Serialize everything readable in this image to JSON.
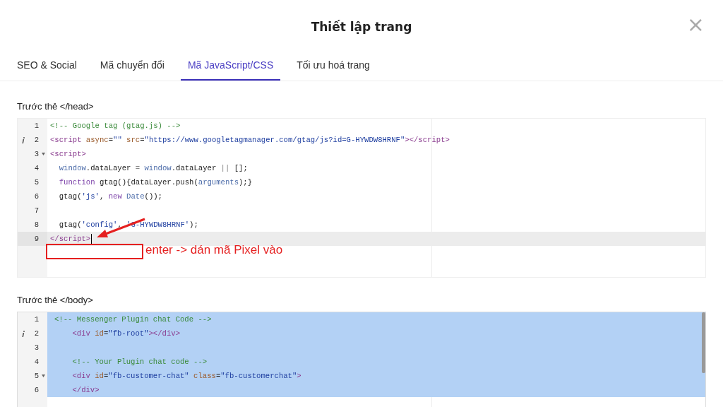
{
  "dialog": {
    "title": "Thiết lập trang",
    "close": "×"
  },
  "tabs": [
    {
      "label": "SEO & Social",
      "selected": false
    },
    {
      "label": "Mã chuyển đổi",
      "selected": false
    },
    {
      "label": "Mã JavaScript/CSS",
      "selected": true
    },
    {
      "label": "Tối ưu hoá trang",
      "selected": false
    }
  ],
  "editors": [
    {
      "label": "Trước thẻ </head>",
      "lines": [
        {
          "number": "1",
          "info": false,
          "foldable": false,
          "active": false,
          "selected": false,
          "tokens": [
            {
              "t": "<!-- Google tag (gtag.js) -->",
              "kind": "comment"
            }
          ]
        },
        {
          "number": "2",
          "info": true,
          "foldable": false,
          "active": false,
          "selected": false,
          "tokens": [
            {
              "t": "<script",
              "kind": "tag"
            },
            {
              "t": " async",
              "kind": "attr"
            },
            {
              "t": "=",
              "kind": "plain"
            },
            {
              "t": "\"\"",
              "kind": "string"
            },
            {
              "t": " src",
              "kind": "attr"
            },
            {
              "t": "=",
              "kind": "plain"
            },
            {
              "t": "\"https://www.googletagmanager.com/gtag/js?id=G-HYWDW8HRNF\"",
              "kind": "string"
            },
            {
              "t": "></script>",
              "kind": "tag"
            }
          ]
        },
        {
          "number": "3",
          "info": false,
          "foldable": true,
          "active": false,
          "selected": false,
          "tokens": [
            {
              "t": "<script>",
              "kind": "tag"
            }
          ]
        },
        {
          "number": "4",
          "info": false,
          "foldable": false,
          "active": false,
          "selected": false,
          "tokens": [
            {
              "t": "  window",
              "kind": "variable"
            },
            {
              "t": ".dataLayer ",
              "kind": "plain"
            },
            {
              "t": "=",
              "kind": "operator"
            },
            {
              "t": " window",
              "kind": "variable"
            },
            {
              "t": ".dataLayer ",
              "kind": "plain"
            },
            {
              "t": "||",
              "kind": "operator"
            },
            {
              "t": " [];",
              "kind": "plain"
            }
          ]
        },
        {
          "number": "5",
          "info": false,
          "foldable": false,
          "active": false,
          "selected": false,
          "tokens": [
            {
              "t": "  function",
              "kind": "keyword"
            },
            {
              "t": " gtag(){dataLayer.push(",
              "kind": "plain"
            },
            {
              "t": "arguments",
              "kind": "variable"
            },
            {
              "t": ");}",
              "kind": "plain"
            }
          ]
        },
        {
          "number": "6",
          "info": false,
          "foldable": false,
          "active": false,
          "selected": false,
          "tokens": [
            {
              "t": "  gtag(",
              "kind": "plain"
            },
            {
              "t": "'js'",
              "kind": "string"
            },
            {
              "t": ", ",
              "kind": "plain"
            },
            {
              "t": "new",
              "kind": "keyword"
            },
            {
              "t": " Date",
              "kind": "variable"
            },
            {
              "t": "());",
              "kind": "plain"
            }
          ]
        },
        {
          "number": "7",
          "info": false,
          "foldable": false,
          "active": false,
          "selected": false
        },
        {
          "number": "8",
          "info": false,
          "foldable": false,
          "active": false,
          "selected": false,
          "tokens": [
            {
              "t": "  gtag(",
              "kind": "plain"
            },
            {
              "t": "'config'",
              "kind": "string"
            },
            {
              "t": ", ",
              "kind": "plain"
            },
            {
              "t": "'G-HYWDW8HRNF'",
              "kind": "string"
            },
            {
              "t": ");",
              "kind": "plain"
            }
          ]
        },
        {
          "number": "9",
          "info": false,
          "foldable": false,
          "active": true,
          "selected": false,
          "tokens": [
            {
              "t": "</script>",
              "kind": "tag"
            }
          ]
        }
      ],
      "annotation": "enter -> dán mã Pixel vào"
    },
    {
      "label": "Trước thẻ </body>",
      "lines": [
        {
          "number": "1",
          "info": false,
          "foldable": false,
          "active": false,
          "selected": true,
          "tokens": [
            {
              "t": "<!-- Messenger Plugin chat Code -->",
              "kind": "comment"
            }
          ]
        },
        {
          "number": "2",
          "info": true,
          "foldable": false,
          "active": false,
          "selected": true,
          "tokens": [
            {
              "t": "    <div",
              "kind": "tag"
            },
            {
              "t": " id",
              "kind": "attr"
            },
            {
              "t": "=",
              "kind": "plain"
            },
            {
              "t": "\"fb-root\"",
              "kind": "string"
            },
            {
              "t": "></div>",
              "kind": "tag"
            }
          ]
        },
        {
          "number": "3",
          "info": false,
          "foldable": false,
          "active": false,
          "selected": true
        },
        {
          "number": "4",
          "info": false,
          "foldable": false,
          "active": false,
          "selected": true,
          "tokens": [
            {
              "t": "    <!-- Your Plugin chat code -->",
              "kind": "comment"
            }
          ]
        },
        {
          "number": "5",
          "info": false,
          "foldable": true,
          "active": false,
          "selected": true,
          "tokens": [
            {
              "t": "    <div",
              "kind": "tag"
            },
            {
              "t": " id",
              "kind": "attr"
            },
            {
              "t": "=",
              "kind": "plain"
            },
            {
              "t": "\"fb-customer-chat\"",
              "kind": "string"
            },
            {
              "t": " class",
              "kind": "attr"
            },
            {
              "t": "=",
              "kind": "plain"
            },
            {
              "t": "\"fb-customerchat\"",
              "kind": "string"
            },
            {
              "t": ">",
              "kind": "tag"
            }
          ]
        },
        {
          "number": "6",
          "info": false,
          "foldable": false,
          "active": false,
          "selected": true,
          "tokens": [
            {
              "t": "    </div>",
              "kind": "tag"
            }
          ]
        }
      ]
    }
  ]
}
